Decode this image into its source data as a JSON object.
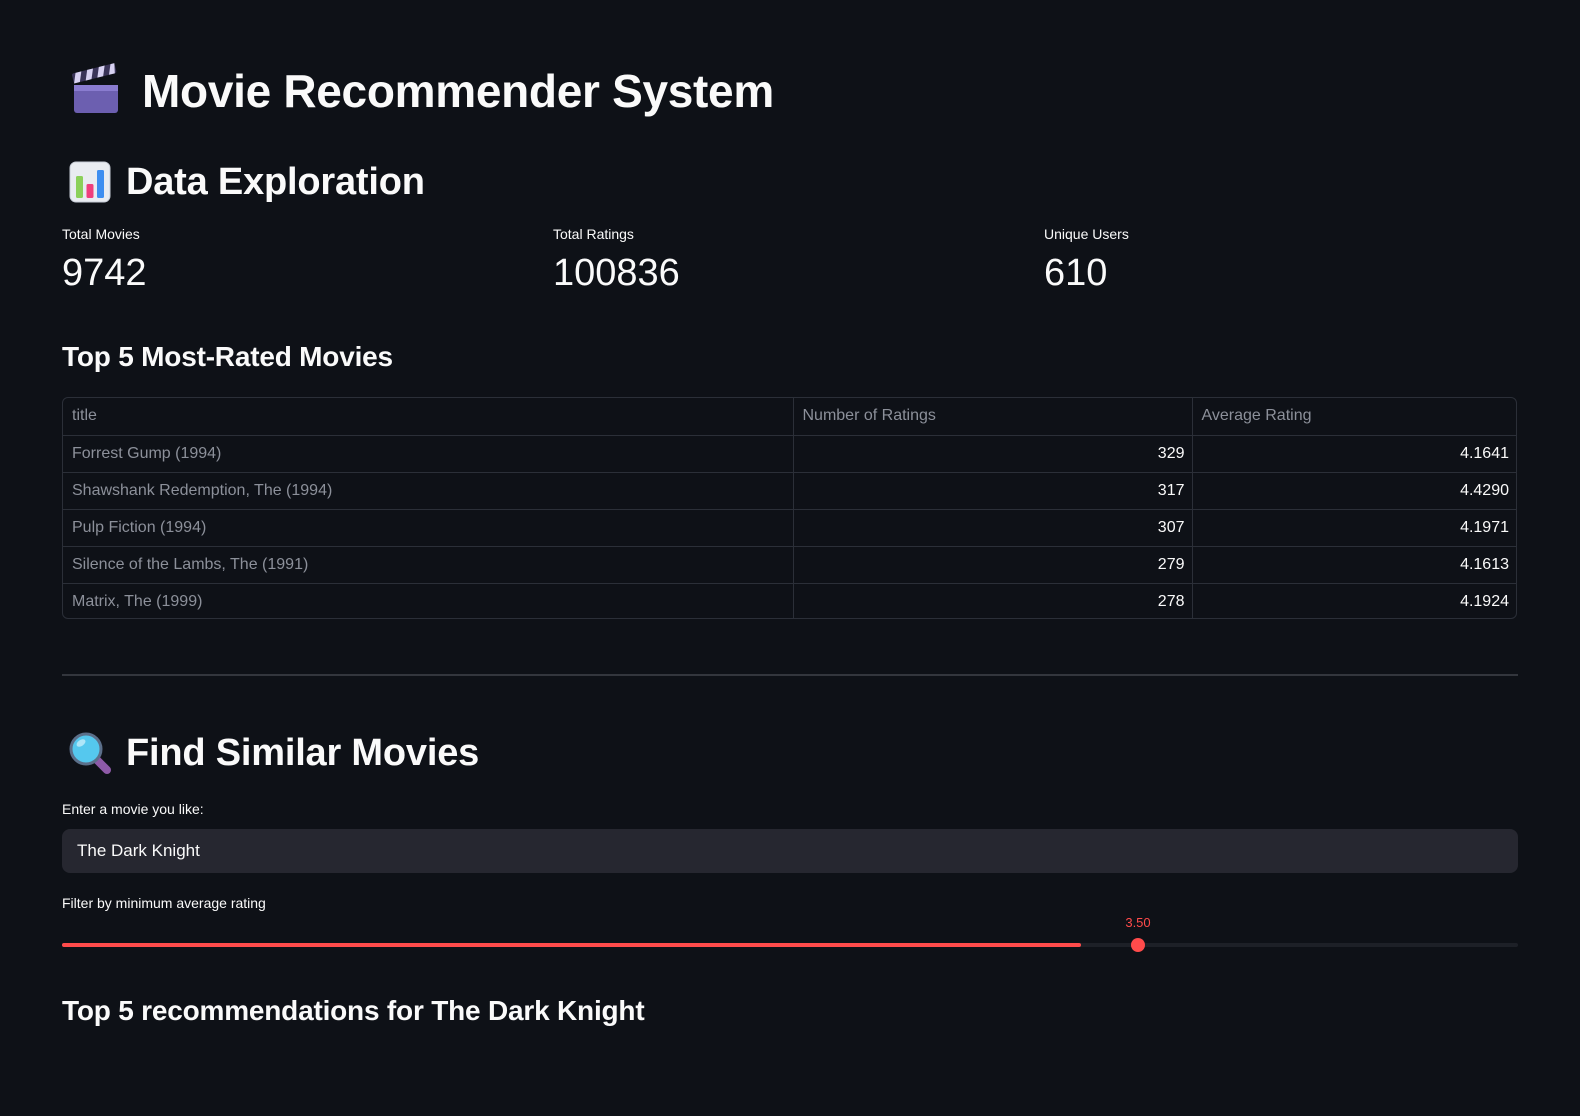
{
  "header": {
    "title_emoji": "🎬",
    "title": "Movie Recommender System"
  },
  "exploration": {
    "emoji": "📊",
    "heading": "Data Exploration",
    "metrics": [
      {
        "label": "Total Movies",
        "value": "9742"
      },
      {
        "label": "Total Ratings",
        "value": "100836"
      },
      {
        "label": "Unique Users",
        "value": "610"
      }
    ],
    "table_heading": "Top 5 Most-Rated Movies",
    "table": {
      "columns": [
        "title",
        "Number of Ratings",
        "Average Rating"
      ],
      "rows": [
        [
          "Forrest Gump (1994)",
          "329",
          "4.1641"
        ],
        [
          "Shawshank Redemption, The (1994)",
          "317",
          "4.4290"
        ],
        [
          "Pulp Fiction (1994)",
          "307",
          "4.1971"
        ],
        [
          "Silence of the Lambs, The (1991)",
          "279",
          "4.1613"
        ],
        [
          "Matrix, The (1999)",
          "278",
          "4.1924"
        ]
      ]
    }
  },
  "similar": {
    "emoji": "🔍",
    "heading": "Find Similar Movies",
    "input_label": "Enter a movie you like:",
    "input_value": "The Dark Knight",
    "slider_label": "Filter by minimum average rating",
    "slider_value_label": "3.50",
    "slider_fraction": 0.7,
    "recommendations_heading": "Top 5 recommendations for The Dark Knight"
  },
  "colors": {
    "background": "#0e1117",
    "accent": "#ff4b4b",
    "input_bg": "#262730"
  }
}
